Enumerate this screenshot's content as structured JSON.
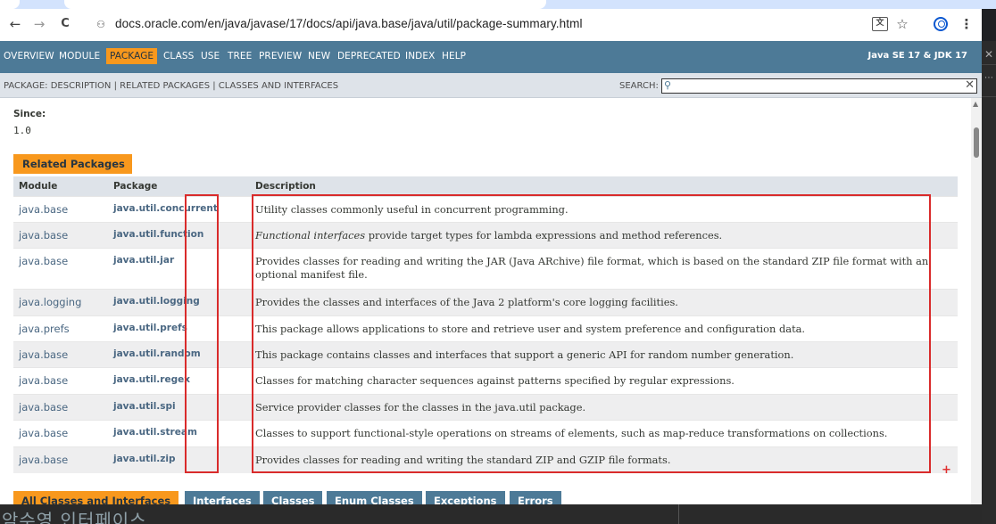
{
  "browser": {
    "url": "docs.oracle.com/en/java/javase/17/docs/api/java.base/java/util/package-summary.html",
    "back_icon": "←",
    "forward_icon": "→",
    "reload_icon": "C",
    "site_icon": "⚇",
    "translate_icon": "文",
    "bookmark_icon": "☆",
    "menu_icon": "⋮"
  },
  "topnav": {
    "items": [
      "OVERVIEW",
      "MODULE",
      "PACKAGE",
      "CLASS",
      "USE",
      "TREE",
      "PREVIEW",
      "NEW",
      "DEPRECATED",
      "INDEX",
      "HELP"
    ],
    "active": "PACKAGE",
    "about": "Java SE 17 & JDK 17"
  },
  "subnav": {
    "links": "PACKAGE: DESCRIPTION | RELATED PACKAGES | CLASSES AND INTERFACES",
    "search_label": "SEARCH:",
    "search_value": ""
  },
  "since": {
    "label": "Since:",
    "value": "1.0"
  },
  "related": {
    "caption": "Related Packages",
    "headers": {
      "module": "Module",
      "package": "Package",
      "description": "Description"
    },
    "rows": [
      {
        "module": "java.base",
        "package": "java.util.concurrent",
        "desc_em": "",
        "description": "Utility classes commonly useful in concurrent programming."
      },
      {
        "module": "java.base",
        "package": "java.util.function",
        "desc_em": "Functional interfaces",
        "description": " provide target types for lambda expressions and method references."
      },
      {
        "module": "java.base",
        "package": "java.util.jar",
        "desc_em": "",
        "description": "Provides classes for reading and writing the JAR (Java ARchive) file format, which is based on the standard ZIP file format with an optional manifest file."
      },
      {
        "module": "java.logging",
        "package": "java.util.logging",
        "desc_em": "",
        "description": "Provides the classes and interfaces of the Java 2 platform's core logging facilities."
      },
      {
        "module": "java.prefs",
        "package": "java.util.prefs",
        "desc_em": "",
        "description": "This package allows applications to store and retrieve user and system preference and configuration data."
      },
      {
        "module": "java.base",
        "package": "java.util.random",
        "desc_em": "",
        "description": "This package contains classes and interfaces that support a generic API for random number generation."
      },
      {
        "module": "java.base",
        "package": "java.util.regex",
        "desc_em": "",
        "description": "Classes for matching character sequences against patterns specified by regular expressions."
      },
      {
        "module": "java.base",
        "package": "java.util.spi",
        "desc_em": "",
        "description": "Service provider classes for the classes in the java.util package."
      },
      {
        "module": "java.base",
        "package": "java.util.stream",
        "desc_em": "",
        "description": "Classes to support functional-style operations on streams of elements, such as map-reduce transformations on collections."
      },
      {
        "module": "java.base",
        "package": "java.util.zip",
        "desc_em": "",
        "description": "Provides classes for reading and writing the standard ZIP and GZIP file formats."
      }
    ]
  },
  "class_tabs": [
    "All Classes and Interfaces",
    "Interfaces",
    "Classes",
    "Enum Classes",
    "Exceptions",
    "Errors"
  ],
  "annotation_plus": "+",
  "overlay_text": "암수영 인터페이스",
  "side_panel": {
    "close": "✕",
    "more": "⋯"
  },
  "colors": {
    "nav": "#4d7a97",
    "accent": "#f8981d",
    "subnav": "#dee3e9",
    "annotation": "#d92b2b"
  }
}
